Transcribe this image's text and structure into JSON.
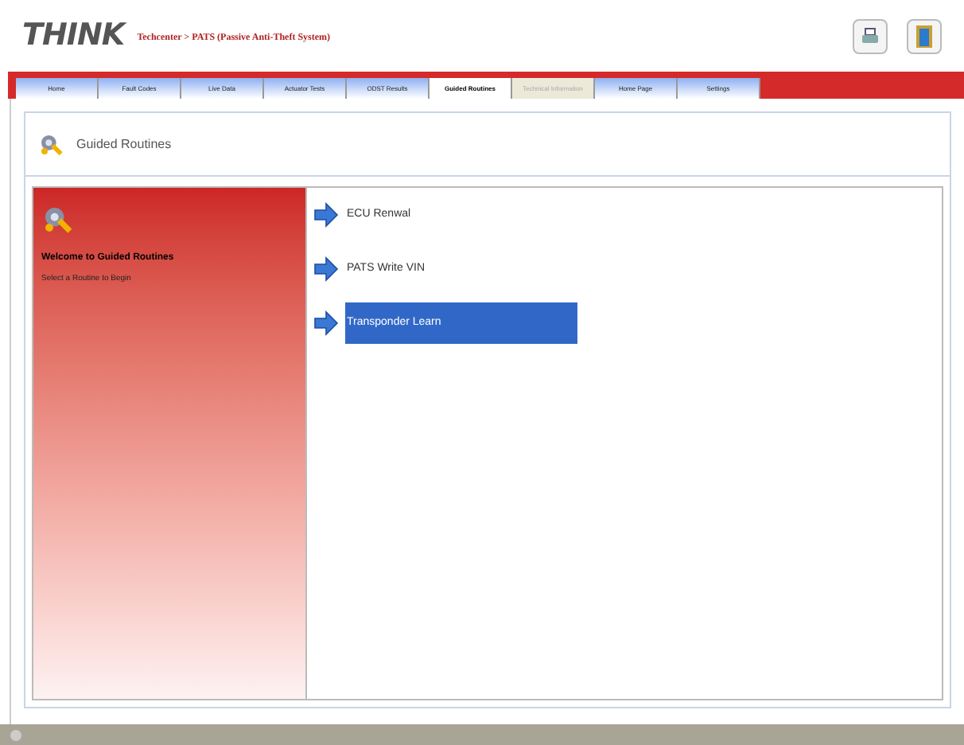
{
  "header": {
    "logo": "THINK",
    "breadcrumb": "Techcenter > PATS (Passive Anti-Theft System)"
  },
  "tabs": [
    {
      "label": "Home",
      "selected": false,
      "disabled": false
    },
    {
      "label": "Fault Codes",
      "selected": false,
      "disabled": false
    },
    {
      "label": "Live Data",
      "selected": false,
      "disabled": false
    },
    {
      "label": "Actuator Tests",
      "selected": false,
      "disabled": false
    },
    {
      "label": "ODST Results",
      "selected": false,
      "disabled": false
    },
    {
      "label": "Guided Routines",
      "selected": true,
      "disabled": false
    },
    {
      "label": "Technical Information",
      "selected": false,
      "disabled": true
    },
    {
      "label": "Home Page",
      "selected": false,
      "disabled": false
    },
    {
      "label": "Settings",
      "selected": false,
      "disabled": false
    }
  ],
  "page_title": "Guided Routines",
  "welcome": {
    "title": "Welcome to Guided Routines",
    "subtitle": "Select a Routine to Begin"
  },
  "routines": [
    {
      "label": "ECU Renwal",
      "selected": false
    },
    {
      "label": "PATS Write VIN",
      "selected": false
    },
    {
      "label": "Transponder Learn",
      "selected": true
    }
  ]
}
